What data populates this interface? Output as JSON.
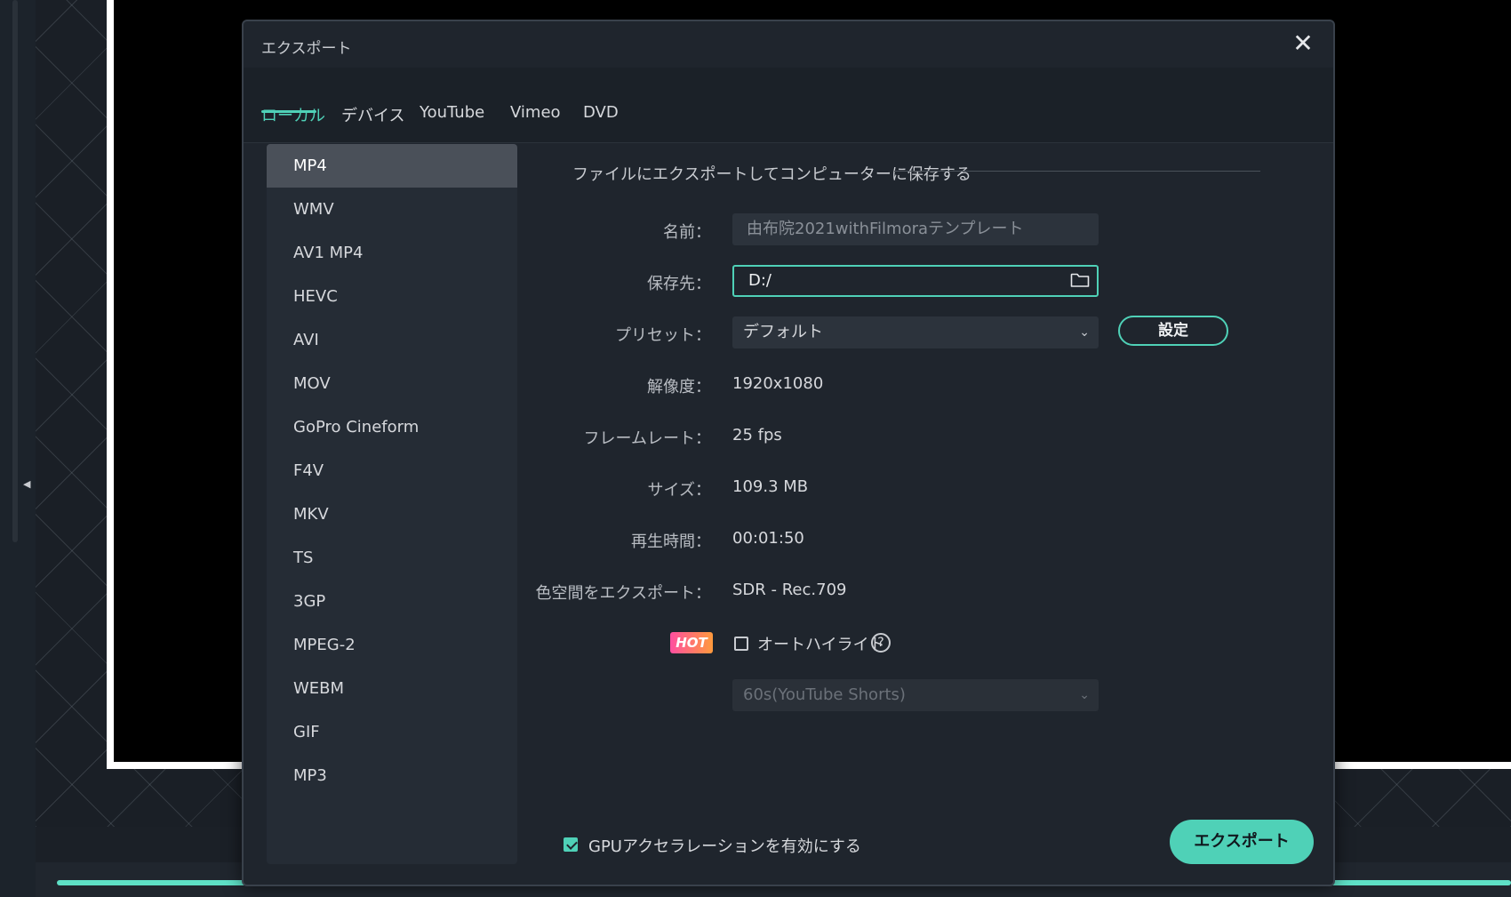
{
  "dialog": {
    "title": "エクスポート",
    "close_icon": "close-icon",
    "tabs": [
      {
        "label": "ローカル",
        "active": true
      },
      {
        "label": "デバイス"
      },
      {
        "label": "YouTube"
      },
      {
        "label": "Vimeo"
      },
      {
        "label": "DVD"
      }
    ],
    "formats": [
      "MP4",
      "WMV",
      "AV1 MP4",
      "HEVC",
      "AVI",
      "MOV",
      "GoPro Cineform",
      "F4V",
      "MKV",
      "TS",
      "3GP",
      "MPEG-2",
      "WEBM",
      "GIF",
      "MP3"
    ],
    "selected_format": "MP4",
    "section_title": "ファイルにエクスポートしてコンピューターに保存する",
    "labels": {
      "name": "名前：",
      "destination": "保存先：",
      "preset": "プリセット：",
      "resolution": "解像度：",
      "framerate": "フレームレート：",
      "size": "サイズ：",
      "duration": "再生時間：",
      "colorspace": "色空間をエクスポート："
    },
    "values": {
      "name": "由布院2021withFilmoraテンプレート",
      "destination": "D:/",
      "preset": "デフォルト",
      "resolution": "1920x1080",
      "framerate": "25 fps",
      "size": "109.3 MB",
      "duration": "00:01:50",
      "colorspace": "SDR - Rec.709"
    },
    "settings_button": "設定",
    "hot_badge": "HOT",
    "auto_highlight_label": "オートハイライト",
    "auto_highlight_checked": false,
    "shorts_select": "60s(YouTube Shorts)",
    "gpu_label": "GPUアクセラレーションを有効にする",
    "gpu_checked": true,
    "export_button": "エクスポート",
    "accent_color": "#4fd1b7"
  }
}
